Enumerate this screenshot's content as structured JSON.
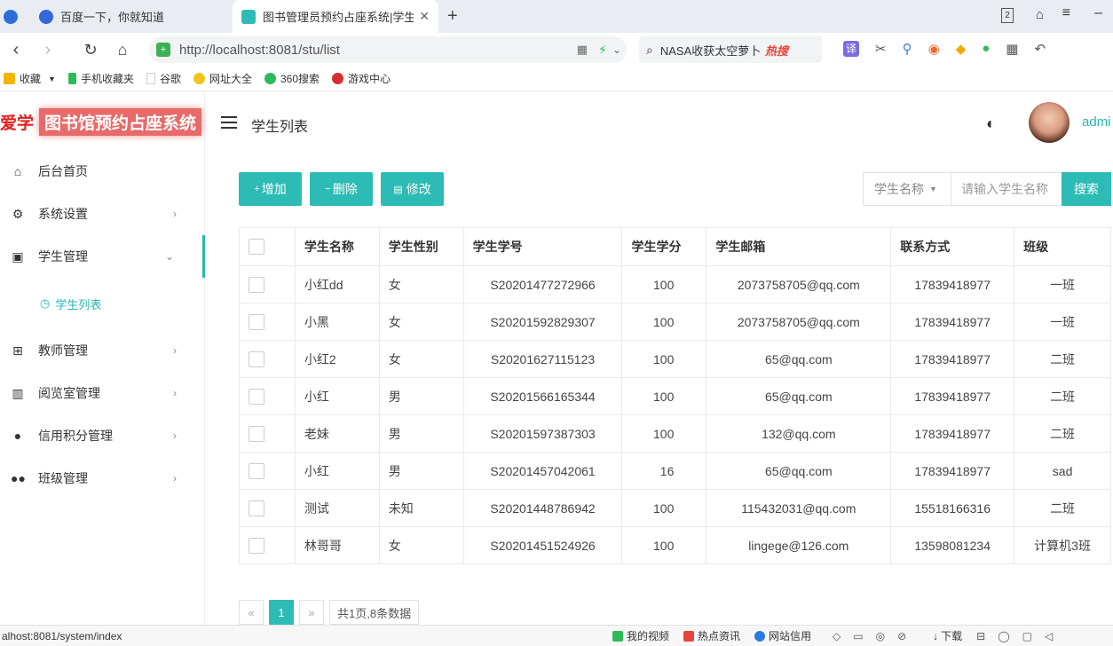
{
  "browser": {
    "tabs": [
      {
        "title": "百度一下，你就知道"
      },
      {
        "title": "图书管理员预约占座系统|学生管"
      }
    ],
    "new_tab": "+",
    "url": "http://localhost:8081/stu/list",
    "search_text": "NASA收获太空萝卜",
    "hot_label": "热搜",
    "bookmarks": [
      "收藏",
      "手机收藏夹",
      "谷歌",
      "网址大全",
      "360搜索",
      "游戏中心"
    ],
    "status_url": "alhost:8081/system/index",
    "status_items": [
      "我的视频",
      "热点资讯",
      "网站信用",
      "下载"
    ]
  },
  "sidebar": {
    "logo_ai": "爱学",
    "logo_title": "图书馆预约占座系统",
    "items": [
      {
        "label": "后台首页",
        "icon": "home-icon"
      },
      {
        "label": "系统设置",
        "icon": "gear-icon"
      },
      {
        "label": "学生管理",
        "icon": "id-card-icon"
      },
      {
        "label": "教师管理",
        "icon": "plus-box-icon"
      },
      {
        "label": "阅览室管理",
        "icon": "book-icon"
      },
      {
        "label": "信用积分管理",
        "icon": "user-icon"
      },
      {
        "label": "班级管理",
        "icon": "group-icon"
      }
    ],
    "sub_item": "学生列表"
  },
  "header": {
    "page_title": "学生列表",
    "username": "admi"
  },
  "toolbar": {
    "add": "增加",
    "delete": "删除",
    "edit": "修改",
    "search_field": "学生名称",
    "search_placeholder": "请输入学生名称",
    "search_button": "搜索"
  },
  "table": {
    "headers": [
      "学生名称",
      "学生性别",
      "学生学号",
      "学生学分",
      "学生邮箱",
      "联系方式",
      "班级"
    ],
    "rows": [
      [
        "小红dd",
        "女",
        "S20201477272966",
        "100",
        "2073758705@qq.com",
        "17839418977",
        "一班"
      ],
      [
        "小黑",
        "女",
        "S20201592829307",
        "100",
        "2073758705@qq.com",
        "17839418977",
        "一班"
      ],
      [
        "小红2",
        "女",
        "S20201627115123",
        "100",
        "65@qq.com",
        "17839418977",
        "二班"
      ],
      [
        "小红",
        "男",
        "S20201566165344",
        "100",
        "65@qq.com",
        "17839418977",
        "二班"
      ],
      [
        "老妹",
        "男",
        "S20201597387303",
        "100",
        "132@qq.com",
        "17839418977",
        "二班"
      ],
      [
        "小红",
        "男",
        "S20201457042061",
        "16",
        "65@qq.com",
        "17839418977",
        "sad"
      ],
      [
        "测试",
        "未知",
        "S20201448786942",
        "100",
        "115432031@qq.com",
        "15518166316",
        "二班"
      ],
      [
        "林哥哥",
        "女",
        "S20201451524926",
        "100",
        "lingege@126.com",
        "13598081234",
        "计算机3班"
      ]
    ]
  },
  "pager": {
    "prev": "«",
    "current": "1",
    "next": "»",
    "info": "共1页,8条数据"
  }
}
